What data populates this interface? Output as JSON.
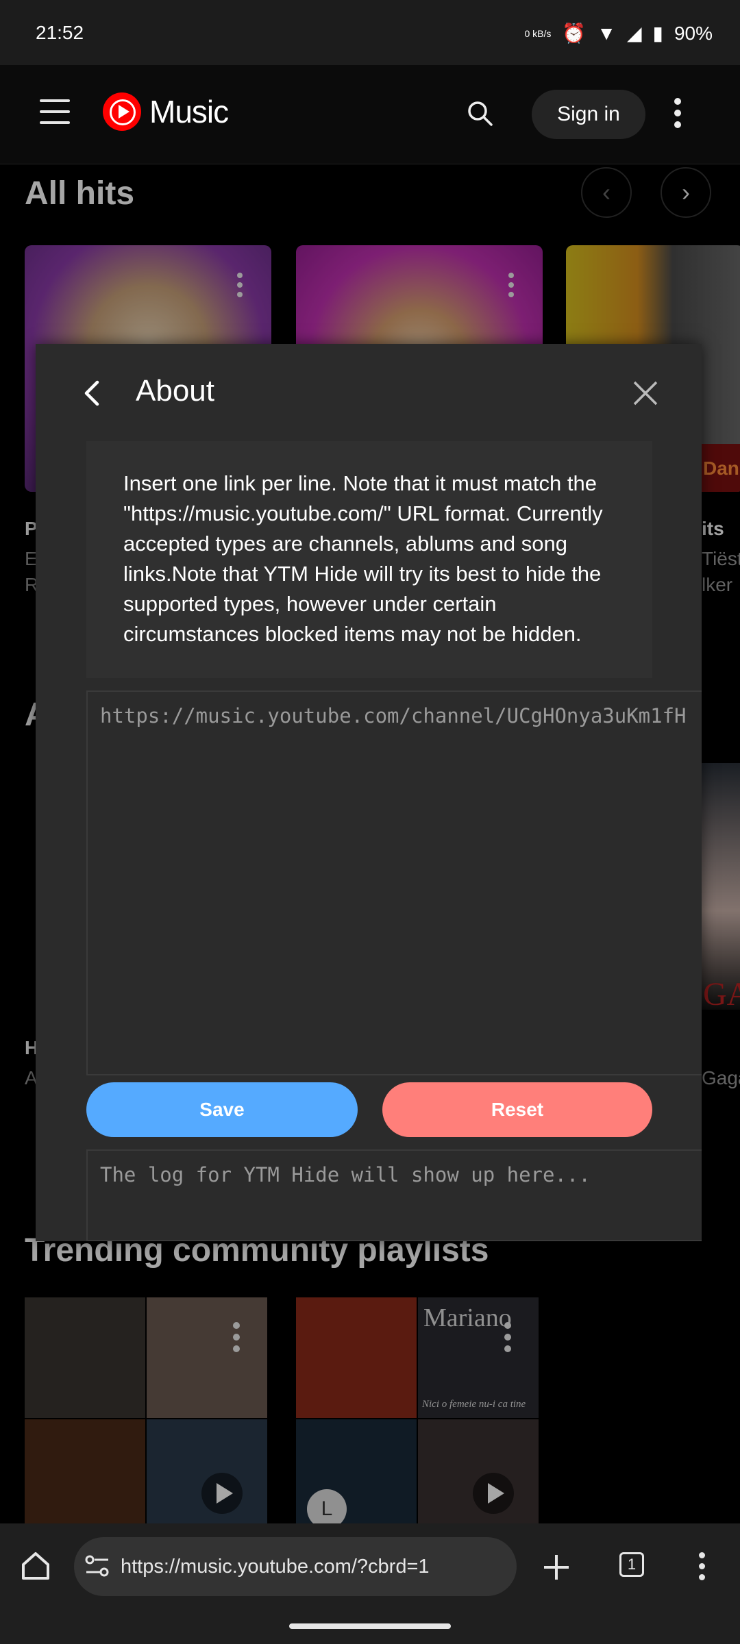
{
  "status_bar": {
    "time": "21:52",
    "battery": "90%",
    "net_speed": "0 kB/s"
  },
  "app_bar": {
    "logo_text": "Music",
    "sign_in_label": "Sign in"
  },
  "background": {
    "section_all_hits": "All hits",
    "section_trending": "Trending community playlists",
    "card_fragment_title": "P",
    "card_fragment_sub1": "E",
    "card_fragment_sub2": "R",
    "card3_fragment_title": "its",
    "card3_fragment_sub1": "Tiëst",
    "card3_fragment_sub2": "lker",
    "card3_overlay_word": "Danc",
    "second_row_fragment": "A",
    "h_fragment": "H",
    "a_fragment": "A",
    "gaga_fragment": "Gaga",
    "gaga_big": "GA",
    "mariano_text": "Mariano",
    "mariano_subtitle": "Nici o femeie nu-i ca tine",
    "avatar_letter": "L"
  },
  "dialog": {
    "title": "About",
    "info_text": "Insert one link per line. Note that it must match the \"https://music.youtube.com/\" URL format. Currently accepted types are channels, ablums and song links.Note that YTM Hide will try its best to hide the supported types, however under certain circumstances blocked items may not be hidden.",
    "url_placeholder": "https://music.youtube.com/channel/UCgHOnya3uKm1fH",
    "save_label": "Save",
    "reset_label": "Reset",
    "log_placeholder": "The log for YTM Hide will show up here..."
  },
  "browser": {
    "url": "https://music.youtube.com/?cbrd=1",
    "tab_count": "1"
  },
  "colors": {
    "save": "#55aaff",
    "reset": "#ff7f7a",
    "brand": "#ff0000"
  }
}
